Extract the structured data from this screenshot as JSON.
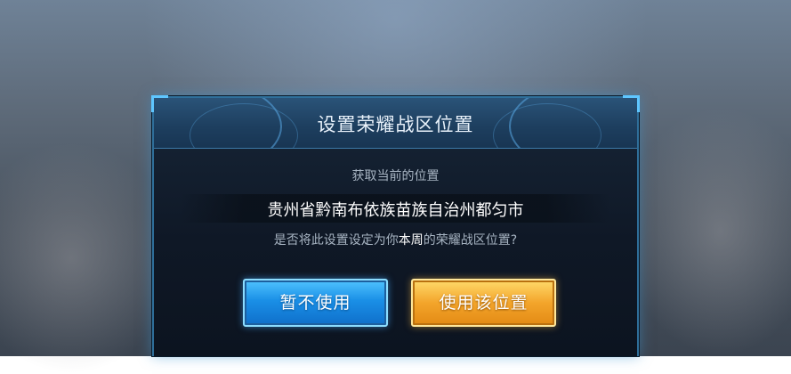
{
  "dialog": {
    "title": "设置荣耀战区位置",
    "current_label": "获取当前的位置",
    "location": "贵州省黔南布依族苗族自治州都匀市",
    "question_prefix": "是否将此设置设定为你",
    "question_highlight": "本周",
    "question_suffix": "的荣耀战区位置?"
  },
  "buttons": {
    "cancel_label": "暂不使用",
    "use_label": "使用该位置"
  },
  "colors": {
    "cancel_button": "#1a8fe6",
    "use_button": "#f3a52b",
    "dialog_border": "#2f6f9a"
  }
}
